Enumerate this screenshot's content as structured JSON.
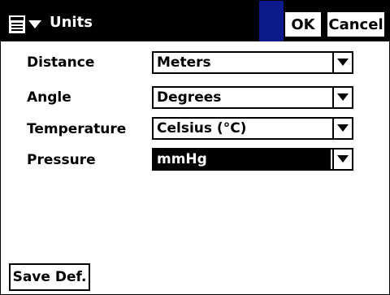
{
  "titlebar": {
    "title": "Units",
    "ok_label": "OK",
    "cancel_label": "Cancel",
    "accent_color": "#0d1a8c"
  },
  "fields": [
    {
      "label": "Distance",
      "value": "Meters"
    },
    {
      "label": "Angle",
      "value": "Degrees"
    },
    {
      "label": "Temperature",
      "value": "Celsius (°C)"
    },
    {
      "label": "Pressure",
      "value": "mmHg"
    }
  ],
  "footer": {
    "save_default_label": "Save Def."
  }
}
